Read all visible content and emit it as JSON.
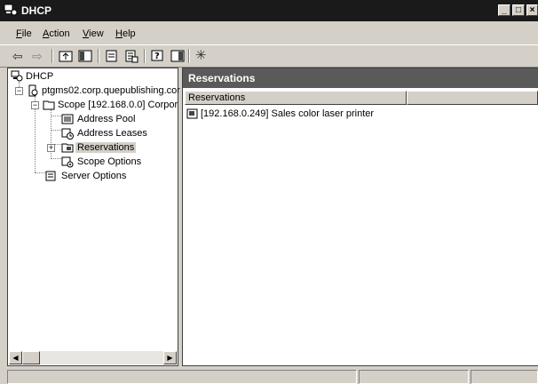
{
  "window": {
    "title": "DHCP",
    "minimize": "_",
    "maximize": "□",
    "close": "×"
  },
  "menu": {
    "items": [
      {
        "key": "F",
        "rest": "ile"
      },
      {
        "key": "A",
        "rest": "ction"
      },
      {
        "key": "V",
        "rest": "iew"
      },
      {
        "key": "H",
        "rest": "elp"
      }
    ]
  },
  "toolbar": {
    "back": "⇦",
    "forward": "⇨",
    "refresh_glyph": "✳"
  },
  "tree": {
    "root": "DHCP",
    "server": "ptgms02.corp.quepublishing.cor",
    "scope": "Scope [192.168.0.0] Corpor",
    "address_pool": "Address Pool",
    "address_leases": "Address Leases",
    "reservations": "Reservations",
    "scope_options": "Scope Options",
    "server_options": "Server Options",
    "expander_minus": "−",
    "expander_plus": "+"
  },
  "details": {
    "title": "Reservations",
    "columns": [
      "Reservations",
      ""
    ],
    "rows": [
      "[192.168.0.249] Sales color laser printer"
    ]
  },
  "scroll": {
    "left_arrow": "◀",
    "right_arrow": "▶"
  }
}
